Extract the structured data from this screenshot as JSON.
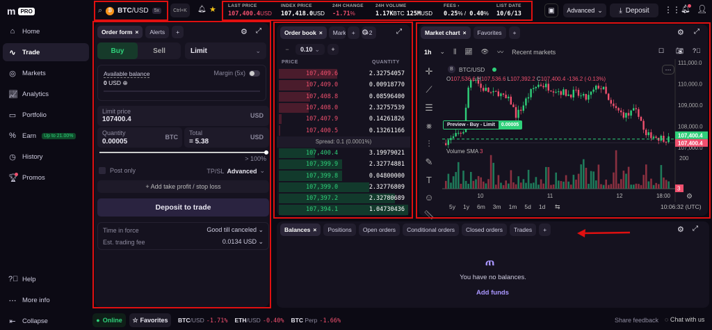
{
  "app": {
    "logo": "m",
    "logo_badge": "PRO"
  },
  "sidebar": {
    "items": [
      {
        "label": "Home",
        "icon": "home-icon"
      },
      {
        "label": "Trade",
        "icon": "trade-icon"
      },
      {
        "label": "Markets",
        "icon": "markets-icon"
      },
      {
        "label": "Analytics",
        "icon": "analytics-icon"
      },
      {
        "label": "Portfolio",
        "icon": "portfolio-icon"
      },
      {
        "label": "Earn",
        "icon": "percent-icon",
        "badge": "Up to 21.00%"
      },
      {
        "label": "History",
        "icon": "history-icon"
      },
      {
        "label": "Promos",
        "icon": "trophy-icon"
      }
    ],
    "bottom": [
      {
        "label": "Help"
      },
      {
        "label": "More info"
      },
      {
        "label": "Collapse"
      }
    ]
  },
  "topbar": {
    "pair": "BTC",
    "pair_quote": "/USD",
    "leverage": "5x",
    "shortcut": "Ctrl+K",
    "stats": [
      {
        "label": "LAST PRICE",
        "value": "107,400.4",
        "unit": "USD",
        "color": "#f0506e"
      },
      {
        "label": "INDEX PRICE",
        "value": "107,418.0",
        "unit": "USD",
        "color": "#ffffff"
      },
      {
        "label": "24H CHANGE",
        "value": "-1.71",
        "unit": "%",
        "color": "#f0506e"
      },
      {
        "label": "24H VOLUME",
        "value": "1.17K",
        "unit": "BTC",
        "value2": "125M",
        "unit2": "USD",
        "color": "#ffffff"
      },
      {
        "label": "FEES  ›",
        "value": "0.25",
        "unit": "% / ",
        "value2": "0.40",
        "unit2": "%",
        "color": "#ffffff"
      },
      {
        "label": "LIST DATE",
        "value": "10/6/13",
        "unit": "",
        "color": "#ffffff"
      }
    ],
    "advanced": "Advanced",
    "deposit": "Deposit"
  },
  "order_form": {
    "tabs": [
      "Order form",
      "Alerts"
    ],
    "buy": "Buy",
    "sell": "Sell",
    "order_type": "Limit",
    "available_balance": "Available balance",
    "margin": "Margin (5x)",
    "balance_value": "0",
    "balance_unit": "USD",
    "limit_price_label": "Limit price",
    "limit_price": "107400.4",
    "limit_unit": "USD",
    "quantity_label": "Quantity",
    "quantity": "0.00005",
    "quantity_unit": "BTC",
    "total_label": "Total",
    "total": "=  5.38",
    "total_unit": "USD",
    "slider_percent": 100,
    "slider_label": "> 100%",
    "post_only": "Post only",
    "tpsl": "TP/SL",
    "tpsl_mode": "Advanced",
    "add_tpsl": "+  Add take profit / stop loss",
    "deposit_to_trade": "Deposit to trade",
    "time_in_force_label": "Time in force",
    "time_in_force": "Good till canceled",
    "fee_label": "Est. trading fee",
    "fee": "0.0134 USD"
  },
  "order_book": {
    "tabs": [
      "Order book",
      "Mark"
    ],
    "more": "+2",
    "tick": "0.10",
    "price_header": "PRICE",
    "qty_header": "QUANTITY",
    "asks": [
      {
        "price": "107,409.6",
        "qty": "2.32754057",
        "depth": 0.45
      },
      {
        "price": "107,409.0",
        "qty": "0.00918770",
        "depth": 0.24
      },
      {
        "price": "107,408.8",
        "qty": "0.08596400",
        "depth": 0.24
      },
      {
        "price": "107,408.0",
        "qty": "2.32757539",
        "depth": 0.23
      },
      {
        "price": "107,407.9",
        "qty": "0.14261826",
        "depth": 0.02
      },
      {
        "price": "107,400.5",
        "qty": "0.13261166",
        "depth": 0.01
      }
    ],
    "spread": "Spread: 0.1 (0.0001%)",
    "bids": [
      {
        "price": "107,400.4",
        "qty": "3.19979021",
        "depth": 0.28
      },
      {
        "price": "107,399.9",
        "qty": "2.32774881",
        "depth": 0.49
      },
      {
        "price": "107,399.8",
        "qty": "0.04800000",
        "depth": 0.49
      },
      {
        "price": "107,399.0",
        "qty": "2.32776809",
        "depth": 0.7
      },
      {
        "price": "107,397.2",
        "qty": "2.32780689",
        "depth": 0.9
      },
      {
        "price": "107,394.1",
        "qty": "1.04730436",
        "depth": 1.0
      }
    ]
  },
  "chart": {
    "tabs": [
      "Market chart",
      "Favorites"
    ],
    "interval": "1h",
    "recent_markets": "Recent markets",
    "symbol": "BTC/USD",
    "ohlc": {
      "o": "107,536.6",
      "h": "107,536.6",
      "l": "107,392.2",
      "c": "107,400.4",
      "chg": "-136.2 (-0.13%)"
    },
    "y_ticks": [
      "111,000.0",
      "110,000.0",
      "109,000.0",
      "108,000.0",
      "107,000.0"
    ],
    "price_tag_bid": "107,400.4",
    "price_tag_ask": "107,400.4",
    "preview_label": "Preview - Buy - Limit",
    "preview_qty": "0.00005",
    "volume_label": "Volume SMA",
    "volume_value": "3",
    "volume_tick": "200",
    "volume_tag": "3",
    "x_ticks": [
      "10",
      "11",
      "12",
      "18:00"
    ],
    "ranges": [
      "5y",
      "1y",
      "6m",
      "3m",
      "1m",
      "5d",
      "1d"
    ],
    "time": "10:06:32 (UTC)"
  },
  "balances": {
    "tabs": [
      "Balances",
      "Positions",
      "Open orders",
      "Conditional orders",
      "Closed orders",
      "Trades"
    ],
    "empty": "You have no balances.",
    "add_funds": "Add funds"
  },
  "status": {
    "online": "Online",
    "favorites": "Favorites",
    "tickers": [
      {
        "base": "BTC",
        "quote": "/USD",
        "chg": "-1.71%"
      },
      {
        "base": "ETH",
        "quote": "/USD",
        "chg": "-0.40%"
      },
      {
        "base": "BTC",
        "quote": " Perp",
        "chg": "-1.66%"
      }
    ],
    "feedback": "Share feedback",
    "chat": "Chat with us"
  },
  "colors": {
    "accent": "#7b61ff",
    "up": "#2fd07a",
    "down": "#f0506e",
    "annotation": "#e01010"
  }
}
